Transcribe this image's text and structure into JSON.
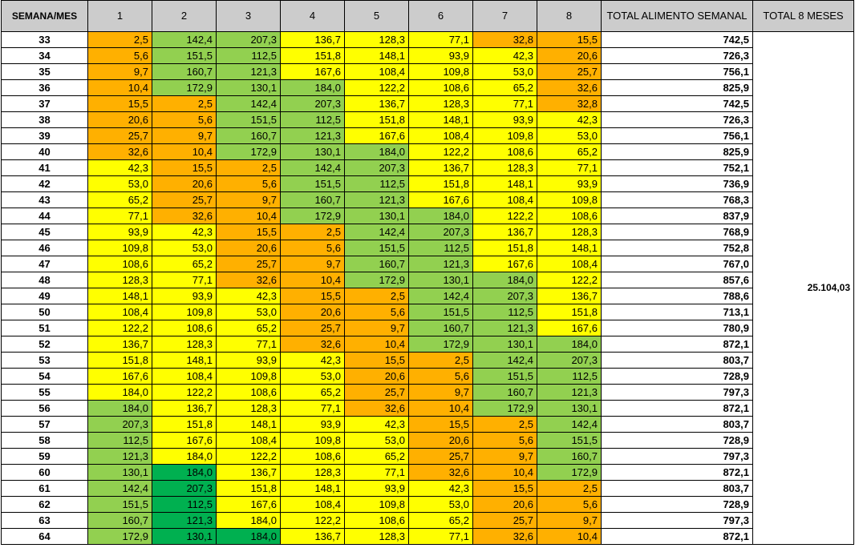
{
  "headers": {
    "week": "SEMANA/MES",
    "months": [
      "1",
      "2",
      "3",
      "4",
      "5",
      "6",
      "7",
      "8"
    ],
    "weekly_total": "TOTAL ALIMENTO SEMANAL",
    "grand_total": "TOTAL 8 MESES"
  },
  "colors": {
    "header_bg": "#cccccc",
    "o": "#ffb000",
    "y": "#ffff00",
    "g": "#92d050",
    "d": "#00b050"
  },
  "grand_total_value": "25.104,03",
  "rows": [
    {
      "week": "33",
      "values": [
        "2,5",
        "142,4",
        "207,3",
        "136,7",
        "128,3",
        "77,1",
        "32,8",
        "15,5"
      ],
      "colors": [
        "o",
        "g",
        "g",
        "y",
        "y",
        "y",
        "o",
        "o"
      ],
      "total": "742,5"
    },
    {
      "week": "34",
      "values": [
        "5,6",
        "151,5",
        "112,5",
        "151,8",
        "148,1",
        "93,9",
        "42,3",
        "20,6"
      ],
      "colors": [
        "o",
        "g",
        "g",
        "y",
        "y",
        "y",
        "y",
        "o"
      ],
      "total": "726,3"
    },
    {
      "week": "35",
      "values": [
        "9,7",
        "160,7",
        "121,3",
        "167,6",
        "108,4",
        "109,8",
        "53,0",
        "25,7"
      ],
      "colors": [
        "o",
        "g",
        "g",
        "y",
        "y",
        "y",
        "y",
        "o"
      ],
      "total": "756,1"
    },
    {
      "week": "36",
      "values": [
        "10,4",
        "172,9",
        "130,1",
        "184,0",
        "122,2",
        "108,6",
        "65,2",
        "32,6"
      ],
      "colors": [
        "o",
        "g",
        "g",
        "g",
        "y",
        "y",
        "y",
        "o"
      ],
      "total": "825,9"
    },
    {
      "week": "37",
      "values": [
        "15,5",
        "2,5",
        "142,4",
        "207,3",
        "136,7",
        "128,3",
        "77,1",
        "32,8"
      ],
      "colors": [
        "o",
        "o",
        "g",
        "g",
        "y",
        "y",
        "y",
        "o"
      ],
      "total": "742,5"
    },
    {
      "week": "38",
      "values": [
        "20,6",
        "5,6",
        "151,5",
        "112,5",
        "151,8",
        "148,1",
        "93,9",
        "42,3"
      ],
      "colors": [
        "o",
        "o",
        "g",
        "g",
        "y",
        "y",
        "y",
        "y"
      ],
      "total": "726,3"
    },
    {
      "week": "39",
      "values": [
        "25,7",
        "9,7",
        "160,7",
        "121,3",
        "167,6",
        "108,4",
        "109,8",
        "53,0"
      ],
      "colors": [
        "o",
        "o",
        "g",
        "g",
        "y",
        "y",
        "y",
        "y"
      ],
      "total": "756,1"
    },
    {
      "week": "40",
      "values": [
        "32,6",
        "10,4",
        "172,9",
        "130,1",
        "184,0",
        "122,2",
        "108,6",
        "65,2"
      ],
      "colors": [
        "o",
        "o",
        "g",
        "g",
        "g",
        "y",
        "y",
        "y"
      ],
      "total": "825,9"
    },
    {
      "week": "41",
      "values": [
        "42,3",
        "15,5",
        "2,5",
        "142,4",
        "207,3",
        "136,7",
        "128,3",
        "77,1"
      ],
      "colors": [
        "y",
        "o",
        "o",
        "g",
        "g",
        "y",
        "y",
        "y"
      ],
      "total": "752,1"
    },
    {
      "week": "42",
      "values": [
        "53,0",
        "20,6",
        "5,6",
        "151,5",
        "112,5",
        "151,8",
        "148,1",
        "93,9"
      ],
      "colors": [
        "y",
        "o",
        "o",
        "g",
        "g",
        "y",
        "y",
        "y"
      ],
      "total": "736,9"
    },
    {
      "week": "43",
      "values": [
        "65,2",
        "25,7",
        "9,7",
        "160,7",
        "121,3",
        "167,6",
        "108,4",
        "109,8"
      ],
      "colors": [
        "y",
        "o",
        "o",
        "g",
        "g",
        "y",
        "y",
        "y"
      ],
      "total": "768,3"
    },
    {
      "week": "44",
      "values": [
        "77,1",
        "32,6",
        "10,4",
        "172,9",
        "130,1",
        "184,0",
        "122,2",
        "108,6"
      ],
      "colors": [
        "y",
        "o",
        "o",
        "g",
        "g",
        "g",
        "y",
        "y"
      ],
      "total": "837,9"
    },
    {
      "week": "45",
      "values": [
        "93,9",
        "42,3",
        "15,5",
        "2,5",
        "142,4",
        "207,3",
        "136,7",
        "128,3"
      ],
      "colors": [
        "y",
        "y",
        "o",
        "o",
        "g",
        "g",
        "y",
        "y"
      ],
      "total": "768,9"
    },
    {
      "week": "46",
      "values": [
        "109,8",
        "53,0",
        "20,6",
        "5,6",
        "151,5",
        "112,5",
        "151,8",
        "148,1"
      ],
      "colors": [
        "y",
        "y",
        "o",
        "o",
        "g",
        "g",
        "y",
        "y"
      ],
      "total": "752,8"
    },
    {
      "week": "47",
      "values": [
        "108,6",
        "65,2",
        "25,7",
        "9,7",
        "160,7",
        "121,3",
        "167,6",
        "108,4"
      ],
      "colors": [
        "y",
        "y",
        "o",
        "o",
        "g",
        "g",
        "y",
        "y"
      ],
      "total": "767,0"
    },
    {
      "week": "48",
      "values": [
        "128,3",
        "77,1",
        "32,6",
        "10,4",
        "172,9",
        "130,1",
        "184,0",
        "122,2"
      ],
      "colors": [
        "y",
        "y",
        "o",
        "o",
        "g",
        "g",
        "g",
        "y"
      ],
      "total": "857,6"
    },
    {
      "week": "49",
      "values": [
        "148,1",
        "93,9",
        "42,3",
        "15,5",
        "2,5",
        "142,4",
        "207,3",
        "136,7"
      ],
      "colors": [
        "y",
        "y",
        "y",
        "o",
        "o",
        "g",
        "g",
        "y"
      ],
      "total": "788,6"
    },
    {
      "week": "50",
      "values": [
        "108,4",
        "109,8",
        "53,0",
        "20,6",
        "5,6",
        "151,5",
        "112,5",
        "151,8"
      ],
      "colors": [
        "y",
        "y",
        "y",
        "o",
        "o",
        "g",
        "g",
        "y"
      ],
      "total": "713,1"
    },
    {
      "week": "51",
      "values": [
        "122,2",
        "108,6",
        "65,2",
        "25,7",
        "9,7",
        "160,7",
        "121,3",
        "167,6"
      ],
      "colors": [
        "y",
        "y",
        "y",
        "o",
        "o",
        "g",
        "g",
        "y"
      ],
      "total": "780,9"
    },
    {
      "week": "52",
      "values": [
        "136,7",
        "128,3",
        "77,1",
        "32,6",
        "10,4",
        "172,9",
        "130,1",
        "184,0"
      ],
      "colors": [
        "y",
        "y",
        "y",
        "o",
        "o",
        "g",
        "g",
        "g"
      ],
      "total": "872,1"
    },
    {
      "week": "53",
      "values": [
        "151,8",
        "148,1",
        "93,9",
        "42,3",
        "15,5",
        "2,5",
        "142,4",
        "207,3"
      ],
      "colors": [
        "y",
        "y",
        "y",
        "y",
        "o",
        "o",
        "g",
        "g"
      ],
      "total": "803,7"
    },
    {
      "week": "54",
      "values": [
        "167,6",
        "108,4",
        "109,8",
        "53,0",
        "20,6",
        "5,6",
        "151,5",
        "112,5"
      ],
      "colors": [
        "y",
        "y",
        "y",
        "y",
        "o",
        "o",
        "g",
        "g"
      ],
      "total": "728,9"
    },
    {
      "week": "55",
      "values": [
        "184,0",
        "122,2",
        "108,6",
        "65,2",
        "25,7",
        "9,7",
        "160,7",
        "121,3"
      ],
      "colors": [
        "y",
        "y",
        "y",
        "y",
        "o",
        "o",
        "g",
        "g"
      ],
      "total": "797,3"
    },
    {
      "week": "56",
      "values": [
        "184,0",
        "136,7",
        "128,3",
        "77,1",
        "32,6",
        "10,4",
        "172,9",
        "130,1"
      ],
      "colors": [
        "g",
        "y",
        "y",
        "y",
        "o",
        "o",
        "g",
        "g"
      ],
      "total": "872,1"
    },
    {
      "week": "57",
      "values": [
        "207,3",
        "151,8",
        "148,1",
        "93,9",
        "42,3",
        "15,5",
        "2,5",
        "142,4"
      ],
      "colors": [
        "g",
        "y",
        "y",
        "y",
        "y",
        "o",
        "o",
        "g"
      ],
      "total": "803,7"
    },
    {
      "week": "58",
      "values": [
        "112,5",
        "167,6",
        "108,4",
        "109,8",
        "53,0",
        "20,6",
        "5,6",
        "151,5"
      ],
      "colors": [
        "g",
        "y",
        "y",
        "y",
        "y",
        "o",
        "o",
        "g"
      ],
      "total": "728,9"
    },
    {
      "week": "59",
      "values": [
        "121,3",
        "184,0",
        "122,2",
        "108,6",
        "65,2",
        "25,7",
        "9,7",
        "160,7"
      ],
      "colors": [
        "g",
        "y",
        "y",
        "y",
        "y",
        "o",
        "o",
        "g"
      ],
      "total": "797,3"
    },
    {
      "week": "60",
      "values": [
        "130,1",
        "184,0",
        "136,7",
        "128,3",
        "77,1",
        "32,6",
        "10,4",
        "172,9"
      ],
      "colors": [
        "g",
        "d",
        "y",
        "y",
        "y",
        "o",
        "o",
        "g"
      ],
      "total": "872,1"
    },
    {
      "week": "61",
      "values": [
        "142,4",
        "207,3",
        "151,8",
        "148,1",
        "93,9",
        "42,3",
        "15,5",
        "2,5"
      ],
      "colors": [
        "g",
        "d",
        "y",
        "y",
        "y",
        "y",
        "o",
        "o"
      ],
      "total": "803,7"
    },
    {
      "week": "62",
      "values": [
        "151,5",
        "112,5",
        "167,6",
        "108,4",
        "109,8",
        "53,0",
        "20,6",
        "5,6"
      ],
      "colors": [
        "g",
        "d",
        "y",
        "y",
        "y",
        "y",
        "o",
        "o"
      ],
      "total": "728,9"
    },
    {
      "week": "63",
      "values": [
        "160,7",
        "121,3",
        "184,0",
        "122,2",
        "108,6",
        "65,2",
        "25,7",
        "9,7"
      ],
      "colors": [
        "g",
        "d",
        "y",
        "y",
        "y",
        "y",
        "o",
        "o"
      ],
      "total": "797,3"
    },
    {
      "week": "64",
      "values": [
        "172,9",
        "130,1",
        "184,0",
        "136,7",
        "128,3",
        "77,1",
        "32,6",
        "10,4"
      ],
      "colors": [
        "g",
        "d",
        "d",
        "y",
        "y",
        "y",
        "o",
        "o"
      ],
      "total": "872,1"
    }
  ]
}
